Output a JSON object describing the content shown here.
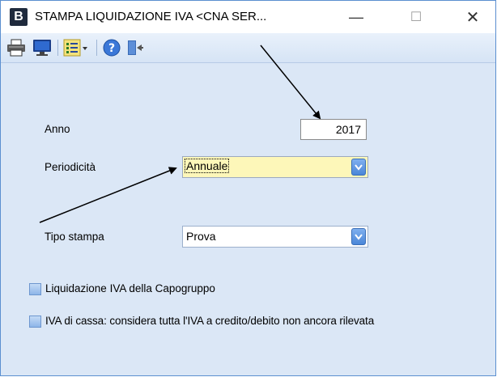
{
  "window": {
    "app_icon_letter": "B",
    "title": "STAMPA LIQUIDAZIONE IVA <CNA SER...",
    "minimize_glyph": "—",
    "maximize_glyph": "☐",
    "close_glyph": "✕"
  },
  "toolbar": {
    "items": [
      "printer-icon",
      "monitor-icon",
      "list-options-icon",
      "help-icon",
      "exit-door-icon"
    ]
  },
  "form": {
    "anno_label": "Anno",
    "anno_value": "2017",
    "periodicita_label": "Periodicità",
    "periodicita_value": "Annuale",
    "tipo_stampa_label": "Tipo stampa",
    "tipo_stampa_value": "Prova",
    "capogruppo_label": "Liquidazione IVA della Capogruppo",
    "capogruppo_checked": false,
    "iva_cassa_label": "IVA di cassa: considera tutta l'IVA a credito/debito non ancora rilevata",
    "iva_cassa_checked": false
  },
  "colors": {
    "window_bg": "#dbe7f6",
    "highlight_field": "#fdf7b9",
    "accent_blue": "#4a86d8"
  }
}
